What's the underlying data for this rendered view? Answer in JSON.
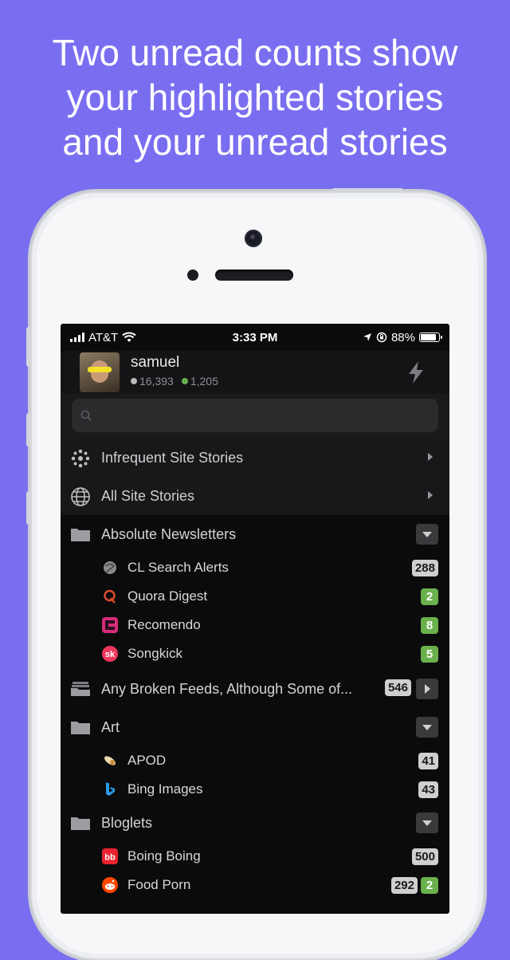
{
  "headline": [
    "Two unread counts show",
    "your highlighted stories",
    "and your unread stories"
  ],
  "colors": {
    "background": "#7a6ef0",
    "positive": "#6ab04c",
    "neutral": "#cfcfd0",
    "accent_lightning": "#7d7d82"
  },
  "status_bar": {
    "carrier": "AT&T",
    "time": "3:33 PM",
    "battery": "88%"
  },
  "profile": {
    "username": "samuel",
    "neutral_count": "16,393",
    "positive_count": "1,205"
  },
  "search": {
    "placeholder": "",
    "value": ""
  },
  "special_feeds": [
    {
      "label": "Infrequent Site Stories",
      "icon": "infrequent-icon"
    },
    {
      "label": "All Site Stories",
      "icon": "globe-icon"
    }
  ],
  "folders": {
    "absolute": {
      "label": "Absolute Newsletters",
      "feeds": [
        {
          "label": "CL Search Alerts",
          "icon": "craigslist-icon",
          "neutral": "288",
          "positive": ""
        },
        {
          "label": "Quora Digest",
          "icon": "quora-icon",
          "neutral": "",
          "positive": "2"
        },
        {
          "label": "Recomendo",
          "icon": "recomendo-icon",
          "neutral": "",
          "positive": "8"
        },
        {
          "label": "Songkick",
          "icon": "songkick-icon",
          "neutral": "",
          "positive": "5"
        }
      ]
    },
    "broken": {
      "label": "Any Broken Feeds, Although Some of...",
      "neutral": "546"
    },
    "art": {
      "label": "Art",
      "feeds": [
        {
          "label": "APOD",
          "icon": "apod-icon",
          "neutral": "41"
        },
        {
          "label": "Bing Images",
          "icon": "bing-icon",
          "neutral": "43"
        }
      ]
    },
    "bloglets": {
      "label": "Bloglets",
      "feeds": [
        {
          "label": "Boing Boing",
          "icon": "boingboing-icon",
          "neutral": "500",
          "positive": ""
        },
        {
          "label": "Food Porn",
          "icon": "reddit-icon",
          "neutral": "292",
          "positive": "2"
        }
      ]
    }
  }
}
